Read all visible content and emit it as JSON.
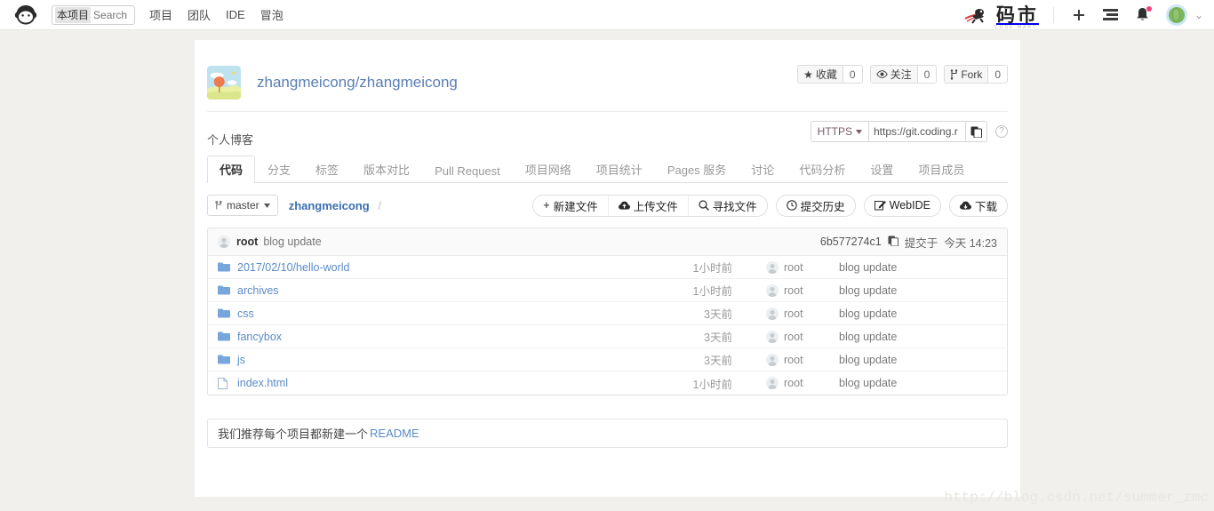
{
  "topbar": {
    "logo": "coding-monkey-logo",
    "search": {
      "scope_label": "本项目",
      "placeholder": "Search",
      "value": ""
    },
    "nav": [
      {
        "label": "项目"
      },
      {
        "label": "团队"
      },
      {
        "label": "IDE"
      },
      {
        "label": "冒泡"
      }
    ],
    "brand": {
      "title": "码市",
      "subtitle": "CODE MART"
    },
    "actions": [
      {
        "name": "add-button",
        "glyph": "+"
      },
      {
        "name": "tasks-button",
        "glyph": "list"
      },
      {
        "name": "notifications-button",
        "glyph": "bell",
        "has_badge": true
      }
    ],
    "user": {
      "avatar": "user-avatar-green",
      "chevron": "⌄"
    }
  },
  "repo": {
    "full_name": "zhangmeicong/zhangmeicong",
    "description": "个人博客",
    "stats": [
      {
        "name": "star",
        "icon": "★",
        "label": "收藏",
        "count": "0"
      },
      {
        "name": "watch",
        "icon": "eye",
        "label": "关注",
        "count": "0"
      },
      {
        "name": "fork",
        "icon": "fork",
        "label": "Fork",
        "count": "0"
      }
    ],
    "clone": {
      "protocol": "HTTPS",
      "url": "https://git.coding.r",
      "copy_title": "copy",
      "help": "?"
    }
  },
  "tabs": [
    {
      "label": "代码",
      "active": true
    },
    {
      "label": "分支",
      "active": false
    },
    {
      "label": "标签",
      "active": false
    },
    {
      "label": "版本对比",
      "active": false
    },
    {
      "label": "Pull Request",
      "active": false
    },
    {
      "label": "项目网络",
      "active": false
    },
    {
      "label": "项目统计",
      "active": false
    },
    {
      "label": "Pages 服务",
      "active": false
    },
    {
      "label": "讨论",
      "active": false
    },
    {
      "label": "代码分析",
      "active": false
    },
    {
      "label": "设置",
      "active": false
    },
    {
      "label": "项目成员",
      "active": false
    }
  ],
  "toolbar": {
    "branch": "master",
    "breadcrumb_root": "zhangmeicong",
    "breadcrumb_sep": "/",
    "group_buttons": [
      {
        "name": "new-file",
        "icon": "+",
        "label": "新建文件"
      },
      {
        "name": "upload-file",
        "icon": "upload",
        "label": "上传文件"
      },
      {
        "name": "find-file",
        "icon": "search",
        "label": "寻找文件"
      }
    ],
    "pill_buttons": [
      {
        "name": "commit-history",
        "icon": "clock",
        "label": "提交历史"
      },
      {
        "name": "webide",
        "icon": "pencil",
        "label": "WebIDE"
      },
      {
        "name": "download",
        "icon": "download",
        "label": "下载"
      }
    ]
  },
  "commit_bar": {
    "author": "root",
    "message": "blog update",
    "sha": "6b577274c1",
    "committed_prefix": "提交于",
    "committed_when": "今天 14:23"
  },
  "files": [
    {
      "type": "folder",
      "name": "2017/02/10/hello-world",
      "time": "1小时前",
      "author": "root",
      "message": "blog update"
    },
    {
      "type": "folder",
      "name": "archives",
      "time": "1小时前",
      "author": "root",
      "message": "blog update"
    },
    {
      "type": "folder",
      "name": "css",
      "time": "3天前",
      "author": "root",
      "message": "blog update"
    },
    {
      "type": "folder",
      "name": "fancybox",
      "time": "3天前",
      "author": "root",
      "message": "blog update"
    },
    {
      "type": "folder",
      "name": "js",
      "time": "3天前",
      "author": "root",
      "message": "blog update"
    },
    {
      "type": "file",
      "name": "index.html",
      "time": "1小时前",
      "author": "root",
      "message": "blog update"
    }
  ],
  "readme_notice": {
    "text": "我们推荐每个项目都新建一个",
    "link": "README"
  },
  "watermark": "http://blog.csdn.net/summer_zmc",
  "colors": {
    "page_bg": "#f2f0ec",
    "panel_bg": "#ffffff",
    "link_blue": "#5b8bc9",
    "title_blue": "#5a7fb5",
    "badge_pink": "#f2437e",
    "avatar_green": "#7bb661"
  }
}
